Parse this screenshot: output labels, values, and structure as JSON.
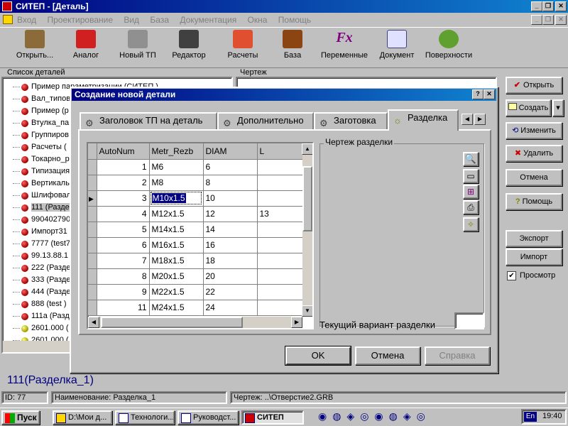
{
  "app_title": "СИТЕП - [Деталь]",
  "menu": [
    "Вход",
    "Проектирование",
    "Вид",
    "База",
    "Документация",
    "Окна",
    "Помощь"
  ],
  "toolbar": [
    "Открыть...",
    "Аналог",
    "Новый ТП",
    "Редактор",
    "Расчеты",
    "База",
    "Переменные",
    "Документ",
    "Поверхности"
  ],
  "left_panel": {
    "title": "Список деталей",
    "items": [
      {
        "label": "Пример параметризации (СИТЕП )",
        "dot": "red"
      },
      {
        "label": "Вал_типовой",
        "dot": "red"
      },
      {
        "label": "Пример (р",
        "dot": "red"
      },
      {
        "label": "Втулка_па",
        "dot": "red"
      },
      {
        "label": "Группиров",
        "dot": "red"
      },
      {
        "label": "Расчеты (",
        "dot": "red"
      },
      {
        "label": "Токарно_р",
        "dot": "red"
      },
      {
        "label": "Типизация",
        "dot": "red"
      },
      {
        "label": "Вертикаль",
        "dot": "red"
      },
      {
        "label": "Шлифовал",
        "dot": "red"
      },
      {
        "label": "111 (Разде",
        "dot": "red",
        "selected": true
      },
      {
        "label": "990402790",
        "dot": "red"
      },
      {
        "label": "Импорт31",
        "dot": "red"
      },
      {
        "label": "7777 (test7",
        "dot": "red"
      },
      {
        "label": "99.13.88.1",
        "dot": "red"
      },
      {
        "label": "222 (Разде",
        "dot": "red"
      },
      {
        "label": "333 (Разде",
        "dot": "red"
      },
      {
        "label": "444 (Разде",
        "dot": "red"
      },
      {
        "label": "888 (test )",
        "dot": "red"
      },
      {
        "label": "111а (Разд",
        "dot": "red"
      },
      {
        "label": "2601.000 (",
        "dot": "yellow"
      },
      {
        "label": "2601.000 (",
        "dot": "yellow"
      },
      {
        "label": "2601.000 (",
        "dot": "yellow"
      }
    ]
  },
  "middle_panel_title": "Чертеж",
  "right_buttons": [
    "Открыть",
    "Создать",
    "Изменить",
    "Удалить",
    "Отмена",
    "Помощь",
    "Экспорт",
    "Импорт"
  ],
  "preview_checkbox": {
    "label": "Просмотр",
    "checked": true
  },
  "detail_caption": "111(Разделка_1)",
  "dialog": {
    "title": "Создание новой детали",
    "tabs": [
      "Заголовок ТП на деталь",
      "Дополнительно",
      "Заготовка",
      "Разделка"
    ],
    "active_tab": 3,
    "grid": {
      "columns": [
        "AutoNum",
        "Metr_Rezb",
        "DIAM",
        "L"
      ],
      "rows": [
        [
          "1",
          "M6",
          "6",
          ""
        ],
        [
          "2",
          "M8",
          "8",
          ""
        ],
        [
          "3",
          "M10x1.5",
          "10",
          ""
        ],
        [
          "4",
          "M12x1.5",
          "12",
          "13"
        ],
        [
          "5",
          "M14x1.5",
          "14",
          ""
        ],
        [
          "6",
          "M16x1.5",
          "16",
          ""
        ],
        [
          "7",
          "M18x1.5",
          "18",
          ""
        ],
        [
          "8",
          "M20x1.5",
          "20",
          ""
        ],
        [
          "9",
          "M22x1.5",
          "22",
          ""
        ],
        [
          "11",
          "M24x1.5",
          "24",
          ""
        ]
      ],
      "current_row": 2
    },
    "drawing_group_title": "Чертеж разделки",
    "current_variant_label": "Текущий вариант разделки",
    "current_variant_value": "",
    "ok_label": "OK",
    "cancel_label": "Отмена",
    "help_label": "Справка"
  },
  "status": {
    "id": "ID: 77",
    "name": "Наименование: Разделка_1",
    "drawing": "Чертеж: ..\\Отверстие2.GRB"
  },
  "taskbar": {
    "start": "Пуск",
    "tasks": [
      "D:\\Мои д...",
      "Технологи...",
      "Руководст...",
      "СИТЕП"
    ],
    "lang": "En",
    "time": "19:40"
  }
}
